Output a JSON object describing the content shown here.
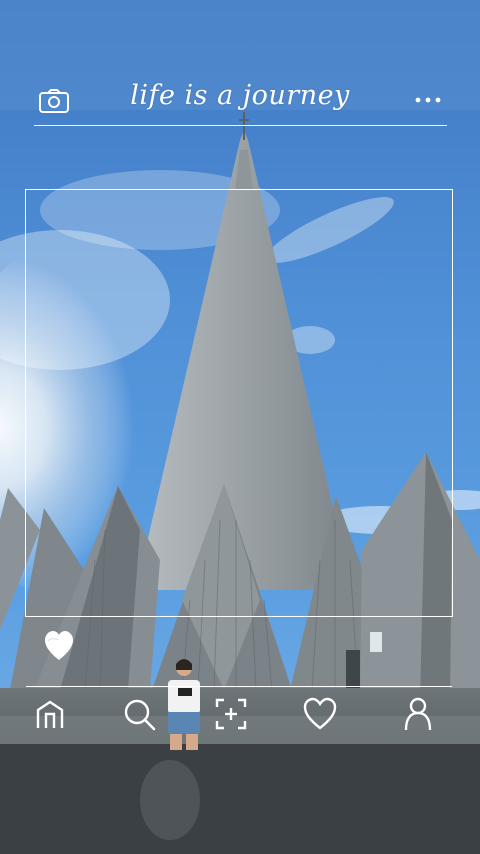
{
  "header": {
    "title": "life is a journey",
    "camera_icon": "camera-icon",
    "more_icon": "more-icon"
  },
  "bottom_nav": {
    "items": [
      {
        "icon": "home-icon"
      },
      {
        "icon": "search-icon"
      },
      {
        "icon": "add-icon"
      },
      {
        "icon": "heart-icon"
      },
      {
        "icon": "profile-icon"
      }
    ]
  },
  "floating_heart": "heart-icon",
  "colors": {
    "sky_top": "#2e6fbf",
    "sky_mid": "#5a9de0",
    "building": "#8d959a",
    "overlay_lines": "#ffffff"
  }
}
